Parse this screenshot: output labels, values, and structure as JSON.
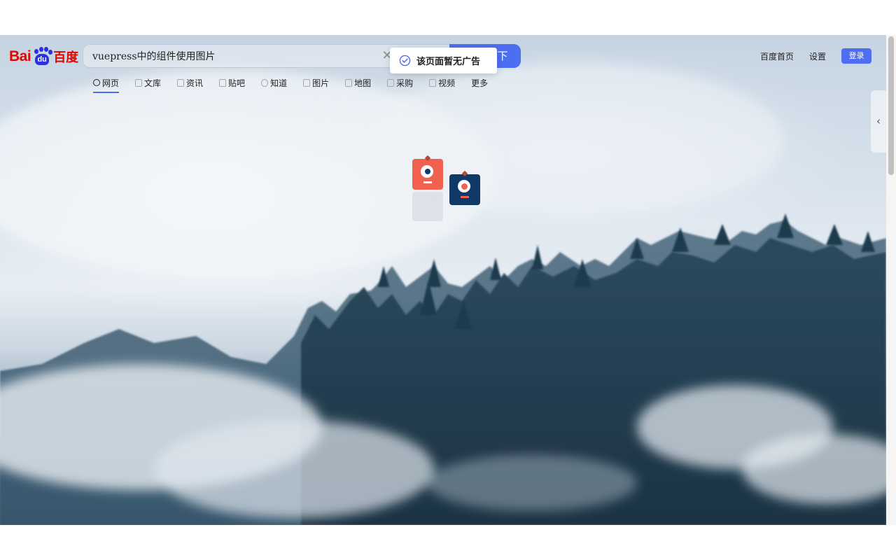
{
  "header": {
    "logo": {
      "latin_part": "Bai",
      "paw_part": "du",
      "cn_part": "百度"
    },
    "search": {
      "value": "vuepress中的组件使用图片",
      "clear_icon": "close-icon",
      "button_label": "百度一下",
      "button_visible_suffix": "下"
    },
    "toast": {
      "icon": "check-circle-icon",
      "message": "该页面暂无广告"
    },
    "top_links": [
      {
        "label": "百度首页"
      },
      {
        "label": "设置"
      }
    ],
    "login_label": "登录"
  },
  "nav": {
    "items": [
      {
        "label": "网页",
        "icon": "search-icon",
        "active": true
      },
      {
        "label": "文库",
        "icon": "document-icon"
      },
      {
        "label": "资讯",
        "icon": "news-icon"
      },
      {
        "label": "贴吧",
        "icon": "tieba-icon"
      },
      {
        "label": "知道",
        "icon": "question-icon"
      },
      {
        "label": "图片",
        "icon": "image-icon"
      },
      {
        "label": "地图",
        "icon": "map-icon"
      },
      {
        "label": "采购",
        "icon": "shopping-icon"
      },
      {
        "label": "视频",
        "icon": "video-icon"
      },
      {
        "label": "更多",
        "icon": ""
      }
    ]
  },
  "side_panel": {
    "icon": "chevron-left-icon"
  },
  "colors": {
    "accent": "#4e6ef2",
    "logo_red": "#e10601",
    "logo_blue": "#2932e1",
    "mascot_orange": "#f0624f",
    "mascot_navy": "#0f3a68"
  }
}
